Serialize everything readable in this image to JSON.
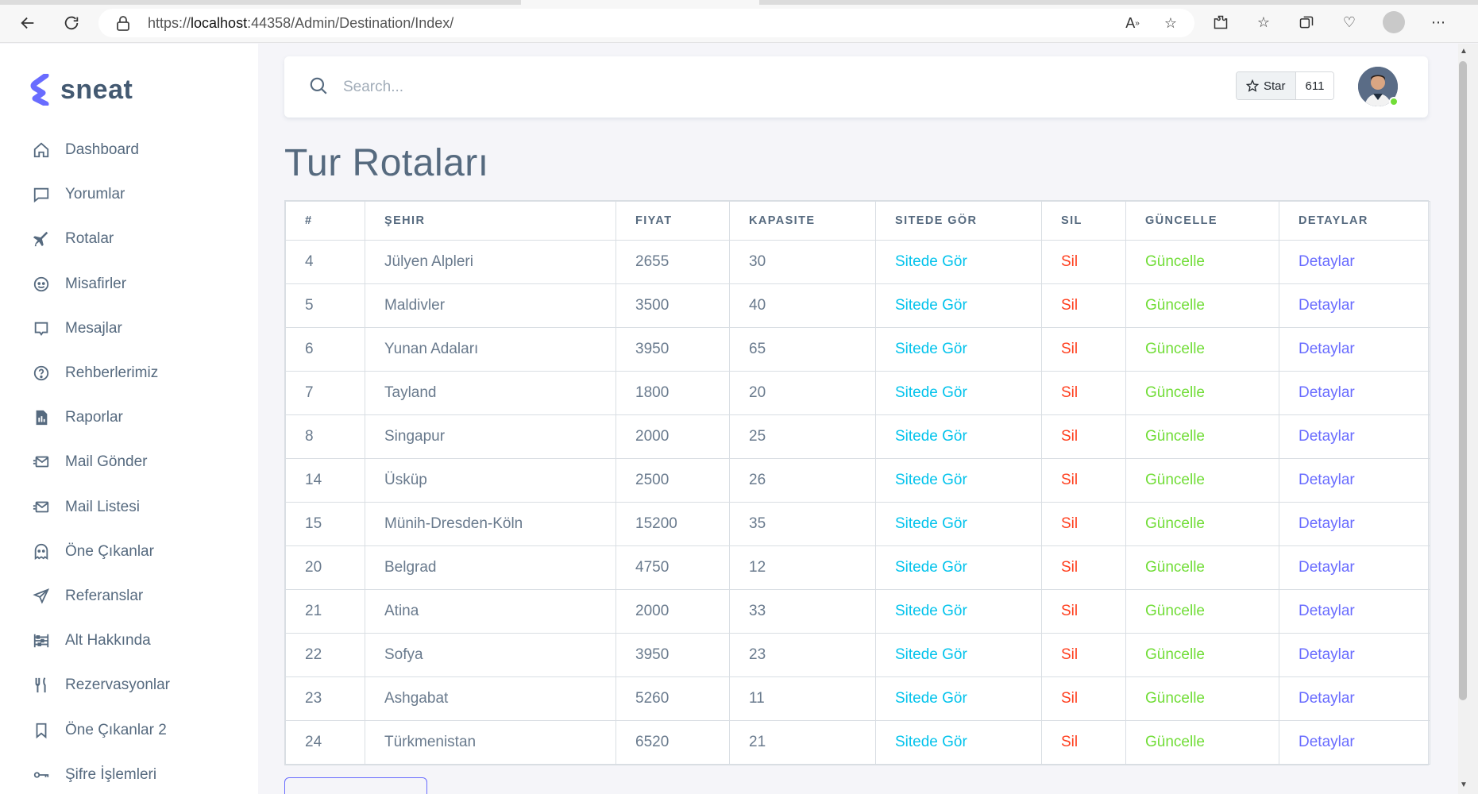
{
  "browser": {
    "url_prefix": "https://",
    "url_host": "localhost",
    "url_rest": ":44358/Admin/Destination/Index/"
  },
  "sidebar": {
    "brand": "sneat",
    "items": [
      {
        "label": "Dashboard",
        "icon": "home-icon"
      },
      {
        "label": "Yorumlar",
        "icon": "comment-icon"
      },
      {
        "label": "Rotalar",
        "icon": "plane-icon"
      },
      {
        "label": "Misafirler",
        "icon": "face-icon"
      },
      {
        "label": "Mesajlar",
        "icon": "message-icon"
      },
      {
        "label": "Rehberlerimiz",
        "icon": "help-circle-icon"
      },
      {
        "label": "Raporlar",
        "icon": "report-icon"
      },
      {
        "label": "Mail Gönder",
        "icon": "mail-send-icon"
      },
      {
        "label": "Mail Listesi",
        "icon": "mail-list-icon"
      },
      {
        "label": "Öne Çıkanlar",
        "icon": "ghost-icon"
      },
      {
        "label": "Referanslar",
        "icon": "send-icon"
      },
      {
        "label": "Alt Hakkında",
        "icon": "abacus-icon"
      },
      {
        "label": "Rezervasyonlar",
        "icon": "restaurant-icon"
      },
      {
        "label": "Öne Çıkanlar 2",
        "icon": "bookmark-icon"
      },
      {
        "label": "Şifre İşlemleri",
        "icon": "key-icon"
      }
    ]
  },
  "navbar": {
    "search_placeholder": "Search...",
    "star_label": "Star",
    "star_count": "611"
  },
  "page": {
    "title": "Tur Rotaları"
  },
  "table": {
    "headers": [
      "#",
      "Şehir",
      "Fiyat",
      "Kapasite",
      "Sitede Gör",
      "Sil",
      "Güncelle",
      "Detaylar"
    ],
    "rows": [
      {
        "id": "4",
        "city": "Jülyen Alpleri",
        "price": "2655",
        "capacity": "30"
      },
      {
        "id": "5",
        "city": "Maldivler",
        "price": "3500",
        "capacity": "40"
      },
      {
        "id": "6",
        "city": "Yunan Adaları",
        "price": "3950",
        "capacity": "65"
      },
      {
        "id": "7",
        "city": "Tayland",
        "price": "1800",
        "capacity": "20"
      },
      {
        "id": "8",
        "city": "Singapur",
        "price": "2000",
        "capacity": "25"
      },
      {
        "id": "14",
        "city": "Üsküp",
        "price": "2500",
        "capacity": "26"
      },
      {
        "id": "15",
        "city": "Münih-Dresden-Köln",
        "price": "15200",
        "capacity": "35"
      },
      {
        "id": "20",
        "city": "Belgrad",
        "price": "4750",
        "capacity": "12"
      },
      {
        "id": "21",
        "city": "Atina",
        "price": "2000",
        "capacity": "33"
      },
      {
        "id": "22",
        "city": "Sofya",
        "price": "3950",
        "capacity": "23"
      },
      {
        "id": "23",
        "city": "Ashgabat",
        "price": "5260",
        "capacity": "11"
      },
      {
        "id": "24",
        "city": "Türkmenistan",
        "price": "6520",
        "capacity": "21"
      }
    ],
    "action_labels": {
      "view": "Sitede Gör",
      "delete": "Sil",
      "update": "Güncelle",
      "details": "Detaylar"
    }
  },
  "colors": {
    "accent": "#696cff",
    "info": "#03c3ec",
    "danger": "#ff3e1d",
    "success": "#71dd37"
  }
}
